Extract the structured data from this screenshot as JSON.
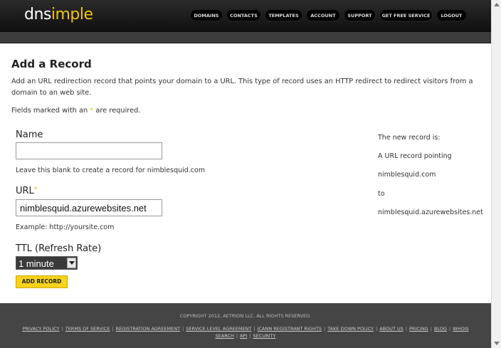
{
  "header": {
    "logo_white": "dns",
    "logo_yellow": "imple",
    "nav": [
      "DOMAINS",
      "CONTACTS",
      "TEMPLATES",
      "ACCOUNT",
      "SUPPORT",
      "GET FREE SERVICE",
      "LOGOUT"
    ]
  },
  "page": {
    "title": "Add a Record",
    "description": "Add an URL redirection record that points your domain to a URL. This type of record uses an HTTP redirect to redirect visitors from a domain to an web site.",
    "required_prefix": "Fields marked with an ",
    "required_star": "*",
    "required_suffix": " are required."
  },
  "form": {
    "name_label": "Name",
    "name_value": "",
    "name_hint": "Leave this blank to create a record for nimblesquid.com",
    "url_label": "URL",
    "url_star": "*",
    "url_value": "nimblesquid.azurewebsites.net",
    "url_hint": "Example: http://yoursite.com",
    "ttl_label": "TTL (Refresh Rate)",
    "ttl_value": "1 minute",
    "submit_label": "ADD RECORD"
  },
  "summary": {
    "line1": "The new record is:",
    "line2": "A URL record pointing",
    "line3": "nimblesquid.com",
    "line4": "to",
    "line5": "nimblesquid.azurewebsites.net"
  },
  "footer": {
    "copyright": "COPYRIGHT 2012, AETRION LLC. ALL RIGHTS RESERVED.",
    "links": [
      "PRIVACY POLICY",
      "TERMS OF SERVICE",
      "REGISTRATION AGREEMENT",
      "SERVICE LEVEL AGREEMENT",
      "ICANN REGISTRANT RIGHTS",
      "TAKE DOWN POLICY",
      "ABOUT US",
      "PRICING",
      "BLOG",
      "WHOIS SEARCH",
      "API",
      "SECURITY"
    ]
  }
}
